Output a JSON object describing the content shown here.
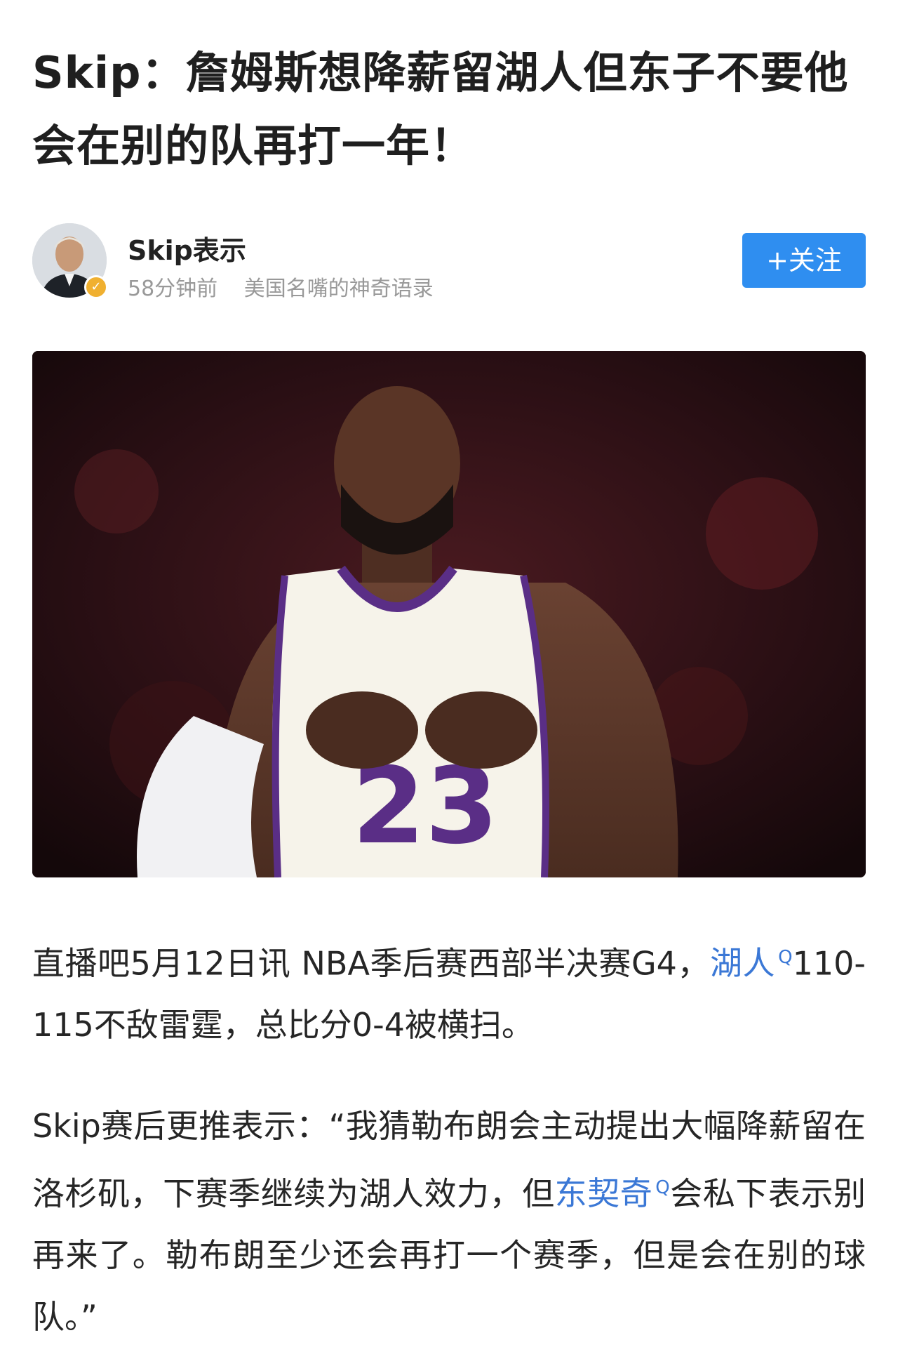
{
  "article": {
    "title": "Skip：詹姆斯想降薪留湖人但东子不要他会在别的队再打一年！"
  },
  "author": {
    "name": "Skip表示",
    "time": "58分钟前",
    "channel": "美国名嘴的神奇语录",
    "follow_label": "+关注"
  },
  "body": {
    "p1_a": "直播吧5月12日讯  NBA季后赛西部半决赛G4，",
    "p1_link": "湖人",
    "p1_b": "110-115不敌雷霆，总比分0-4被横扫。",
    "p2_a": "Skip赛后更推表示：“我猜勒布朗会主动提出大幅降薪留在洛杉矶，下赛季继续为湖人效力，但",
    "p2_link": "东契奇",
    "p2_b": "会私下表示别再来了。勒布朗至少还会再打一个赛季，但是会在别的球队。”"
  },
  "colors": {
    "accent": "#2f8ef0",
    "link": "#3b78d6"
  },
  "icons": {
    "search_hint": "search-icon",
    "verified": "verified-badge-icon"
  }
}
